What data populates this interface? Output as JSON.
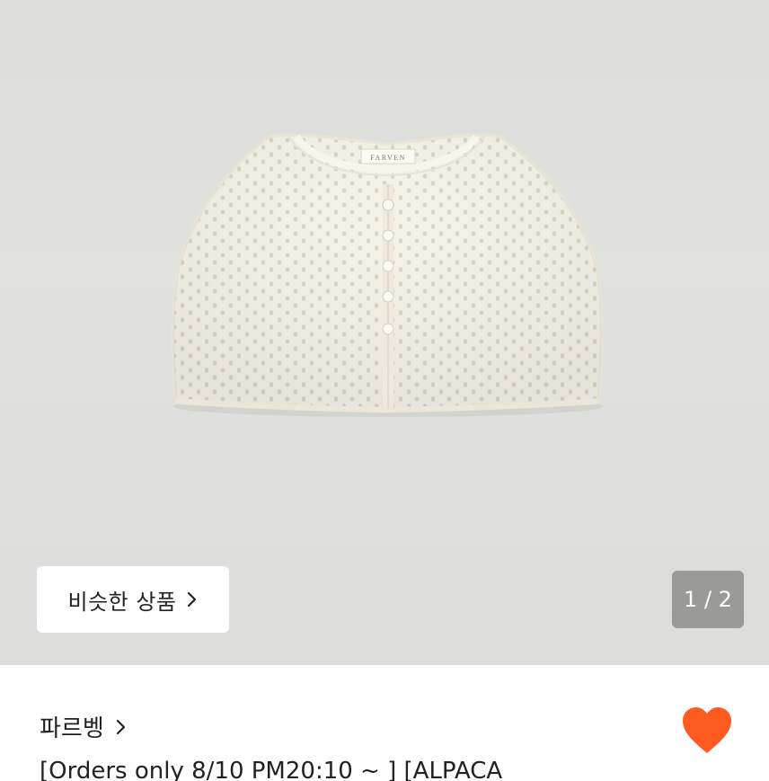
{
  "product": {
    "image": {
      "brand_tag_text": "FARVEN"
    },
    "similar_button": {
      "label": "비슷한 상품"
    },
    "page_indicator": {
      "text": "1 / 2"
    },
    "brand": {
      "name": "파르벵"
    },
    "title": "[Orders only 8/10 PM20:10 ~ ] [ALPACA"
  },
  "colors": {
    "accent": "#ff5a1f",
    "photo_background": "#dedede",
    "garment": "#f4f1e6",
    "indicator_background": "#9a9a98"
  },
  "icons": {
    "similar_chevron": "chevron-right-icon",
    "brand_chevron": "chevron-right-icon",
    "wish": "heart-icon"
  }
}
